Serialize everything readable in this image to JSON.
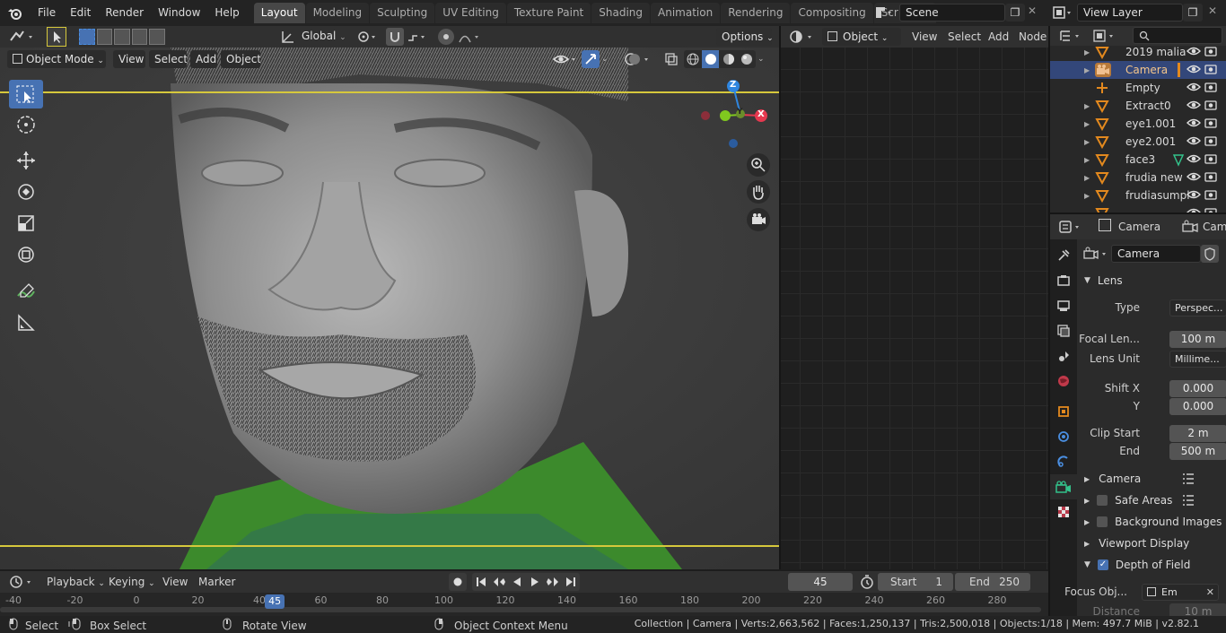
{
  "menus": [
    "File",
    "Edit",
    "Render",
    "Window",
    "Help"
  ],
  "workspaces": [
    {
      "label": "Layout",
      "active": true
    },
    {
      "label": "Modeling"
    },
    {
      "label": "Sculpting"
    },
    {
      "label": "UV Editing"
    },
    {
      "label": "Texture Paint"
    },
    {
      "label": "Shading"
    },
    {
      "label": "Animation"
    },
    {
      "label": "Rendering"
    },
    {
      "label": "Compositing"
    },
    {
      "label": "Scripting"
    }
  ],
  "scene": {
    "name": "Scene"
  },
  "view_layer": {
    "name": "View Layer"
  },
  "viewport_header": {
    "transform_orientation": "Global",
    "options_label": "Options",
    "mode": "Object Mode",
    "menus": [
      "View",
      "Select",
      "Add",
      "Object"
    ]
  },
  "node_header": {
    "object_label": "Object",
    "menus": [
      "View",
      "Select",
      "Add",
      "Node"
    ]
  },
  "gizmo": {
    "z": "Z",
    "y": "Y",
    "x": "X"
  },
  "outliner": {
    "items": [
      {
        "name": "2019 malia",
        "icon": "mesh-icon",
        "selected": false
      },
      {
        "name": "Camera",
        "icon": "camera-icon",
        "selected": true
      },
      {
        "name": "Empty",
        "icon": "empty-icon",
        "selected": false
      },
      {
        "name": "Extract0",
        "icon": "mesh-icon",
        "selected": false
      },
      {
        "name": "eye1.001",
        "icon": "mesh-icon",
        "selected": false
      },
      {
        "name": "eye2.001",
        "icon": "mesh-icon",
        "selected": false
      },
      {
        "name": "face3",
        "icon": "mesh-icon",
        "selected": false
      },
      {
        "name": "frudia new",
        "icon": "mesh-icon",
        "selected": false
      },
      {
        "name": "frudiasumpl",
        "icon": "mesh-icon",
        "selected": false
      },
      {
        "name": "",
        "icon": "mesh-icon",
        "selected": false
      }
    ]
  },
  "properties": {
    "header_object": "Camera",
    "header_data": "Cam",
    "data_name": "Camera",
    "lens_panel": "Lens",
    "type_label": "Type",
    "type_value": "Perspec...",
    "focal_label": "Focal Len...",
    "focal_value": "100 m",
    "lens_unit_label": "Lens Unit",
    "lens_unit_value": "Millime...",
    "shift_x_label": "Shift X",
    "shift_x_value": "0.000",
    "y_label": "Y",
    "y_value": "0.000",
    "clip_start_label": "Clip Start",
    "clip_start_value": "2 m",
    "end_label": "End",
    "end_value": "500 m",
    "camera_panel": "Camera",
    "safe_areas_panel": "Safe Areas",
    "background_panel": "Background Images",
    "viewport_display_panel": "Viewport Display",
    "dof_panel": "Depth of Field",
    "focus_obj_label": "Focus Obj...",
    "focus_obj_value": "Em",
    "distance_label": "Distance",
    "distance_value": "10 m"
  },
  "timeline": {
    "menus": [
      "Playback",
      "Keying",
      "View",
      "Marker"
    ],
    "current_frame": "45",
    "start_label": "Start",
    "start_value": "1",
    "end_label": "End",
    "end_value": "250",
    "ticks": [
      "-40",
      "-20",
      "0",
      "20",
      "40",
      "60",
      "80",
      "100",
      "120",
      "140",
      "160",
      "180",
      "200",
      "220",
      "240",
      "260",
      "280"
    ],
    "playhead": "45"
  },
  "statusbar": {
    "select": "Select",
    "box_select": "Box Select",
    "rotate_view": "Rotate View",
    "context_menu": "Object Context Menu",
    "stats": "Collection | Camera | Verts:2,663,562 | Faces:1,250,137 | Tris:2,500,018 | Objects:1/18 | Mem: 497.7 MiB | v2.82.1"
  },
  "colors": {
    "accent_blue": "#4772b3",
    "selection_row": "#33477a",
    "camera_frame": "#d6c83c",
    "axis_x": "#e5384f",
    "axis_y": "#80c81f",
    "axis_z": "#2f86e0",
    "object_orange": "#e3891e"
  }
}
